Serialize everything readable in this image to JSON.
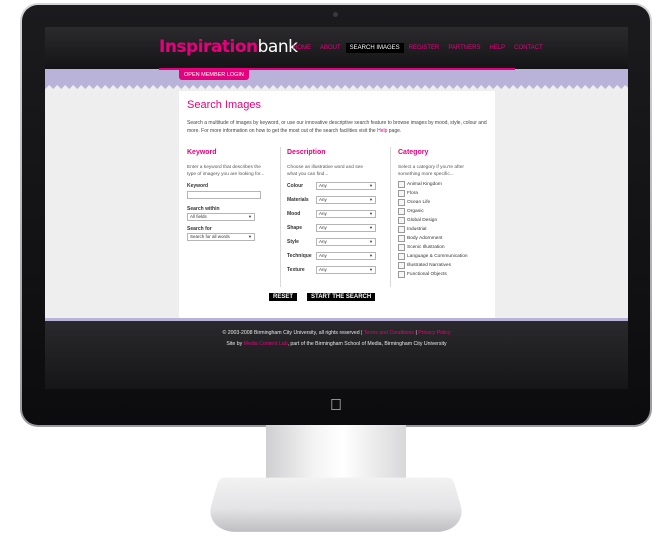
{
  "site": {
    "logo_part1": "Inspiration",
    "logo_part2": "bank",
    "nav": [
      "HOME",
      "ABOUT",
      "SEARCH IMAGES",
      "REGISTER",
      "PARTNERS",
      "HELP",
      "CONTACT"
    ],
    "active_nav": "SEARCH IMAGES",
    "login_button": "OPEN MEMBER LOGIN",
    "brand_color": "#e6007e"
  },
  "page": {
    "title": "Search Images",
    "intro_main": "Search a multitude of images by keyword, or use our innovative descriptive search feature to browse images by mood, style, colour and more. For more information on how to get the most out of the search facilities visit the",
    "intro_link": "Help",
    "intro_end": "page."
  },
  "keyword": {
    "heading": "Keyword",
    "desc": "Enter a keyword that describes the type of imagery you are looking for...",
    "field_label": "Keyword",
    "field_value": "",
    "search_within_label": "Search within",
    "search_within_value": "All fields",
    "search_for_label": "Search for",
    "search_for_value": "Search for all words"
  },
  "description": {
    "heading": "Description",
    "desc": "Choose an illustrative word and see what you can find...",
    "fields": [
      {
        "label": "Colour",
        "value": "Any"
      },
      {
        "label": "Materials",
        "value": "Any"
      },
      {
        "label": "Mood",
        "value": "Any"
      },
      {
        "label": "Shape",
        "value": "Any"
      },
      {
        "label": "Style",
        "value": "Any"
      },
      {
        "label": "Technique",
        "value": "Any"
      },
      {
        "label": "Texture",
        "value": "Any"
      }
    ]
  },
  "category": {
    "heading": "Category",
    "desc": "Select a category if you're after something more specific...",
    "items": [
      "Animal Kingdom",
      "Flora",
      "Ocean Life",
      "Organic",
      "Global Design",
      "Industrial",
      "Body Adornment",
      "Scenic Illustration",
      "Language & Communication",
      "Illustrated Narratives",
      "Functional Objects"
    ]
  },
  "buttons": {
    "reset": "RESET",
    "start": "START THE SEARCH"
  },
  "footer": {
    "copyright": "© 2003-2008 Birmingham City University, all rights reserved |",
    "terms": "Terms and Conditions",
    "sep": "|",
    "privacy": "Privacy Policy",
    "site_by": "Site by",
    "lab": "Media Content Lab",
    "credit_rest": ", part of the Birmingham School of Media, Birmingham City University"
  }
}
